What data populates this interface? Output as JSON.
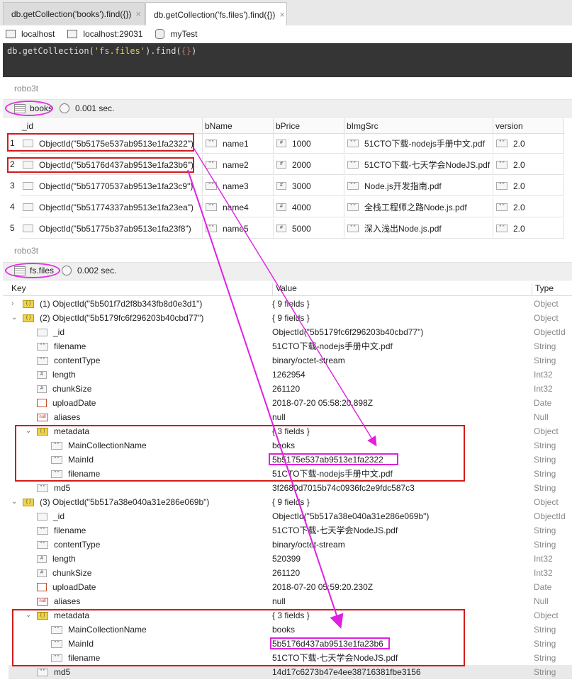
{
  "tabs": [
    {
      "label": "db.getCollection('books').find({})",
      "close": "×"
    },
    {
      "label": "db.getCollection('fs.files').find({})",
      "close": "×"
    }
  ],
  "connection": {
    "host": "localhost",
    "server": "localhost:29031",
    "database": "myTest"
  },
  "shell": {
    "prefix": "db.getCollection(",
    "arg": "'fs.files'",
    "mid": ").find(",
    "brace": "{}",
    "suffix": ")"
  },
  "books_panel": {
    "title": "robo3t",
    "collection": "books",
    "time": "0.001 sec.",
    "columns": [
      "_id",
      "bName",
      "bPrice",
      "bImgSrc",
      "version"
    ],
    "rows": [
      {
        "n": "1",
        "id": "ObjectId(\"5b5175e537ab9513e1fa2322\")",
        "bName": "name1",
        "bPrice": "1000",
        "bImgSrc": "51CTO下载-nodejs手册中文.pdf",
        "version": "2.0"
      },
      {
        "n": "2",
        "id": "ObjectId(\"5b5176d437ab9513e1fa23b6\")",
        "bName": "name2",
        "bPrice": "2000",
        "bImgSrc": "51CTO下载-七天学会NodeJS.pdf",
        "version": "2.0"
      },
      {
        "n": "3",
        "id": "ObjectId(\"5b51770537ab9513e1fa23c9\")",
        "bName": "name3",
        "bPrice": "3000",
        "bImgSrc": "Node.js开发指南.pdf",
        "version": "2.0"
      },
      {
        "n": "4",
        "id": "ObjectId(\"5b51774337ab9513e1fa23ea\")",
        "bName": "name4",
        "bPrice": "4000",
        "bImgSrc": "全栈工程师之路Node.js.pdf",
        "version": "2.0"
      },
      {
        "n": "5",
        "id": "ObjectId(\"5b51775b37ab9513e1fa23f8\")",
        "bName": "name5",
        "bPrice": "5000",
        "bImgSrc": "深入浅出Node.js.pdf",
        "version": "2.0"
      }
    ]
  },
  "files_panel": {
    "title": "robo3t",
    "collection": "fs.files",
    "time": "0.002 sec.",
    "headers": {
      "key": "Key",
      "value": "Value",
      "type": "Type"
    },
    "rows": [
      {
        "arrow": "›",
        "icon": "obj",
        "key": "(1) ObjectId(\"5b501f7d2f8b343fb8d0e3d1\")",
        "value": "{ 9 fields }",
        "type": "Object"
      },
      {
        "arrow": "⌄",
        "icon": "obj",
        "key": "(2) ObjectId(\"5b5179fc6f296203b40cbd77\")",
        "value": "{ 9 fields }",
        "type": "Object"
      },
      {
        "icon": "oid",
        "key": "_id",
        "value": "ObjectId(\"5b5179fc6f296203b40cbd77\")",
        "type": "ObjectId"
      },
      {
        "icon": "str",
        "key": "filename",
        "value": "51CTO下载-nodejs手册中文.pdf",
        "type": "String"
      },
      {
        "icon": "str",
        "key": "contentType",
        "value": "binary/octet-stream",
        "type": "String"
      },
      {
        "icon": "num",
        "key": "length",
        "value": "1262954",
        "type": "Int32"
      },
      {
        "icon": "num",
        "key": "chunkSize",
        "value": "261120",
        "type": "Int32"
      },
      {
        "icon": "date",
        "key": "uploadDate",
        "value": "2018-07-20 05:58:20.898Z",
        "type": "Date"
      },
      {
        "icon": "null",
        "key": "aliases",
        "value": "null",
        "type": "Null"
      },
      {
        "arrow": "⌄",
        "icon": "obj",
        "key": "metadata",
        "value": "{ 3 fields }",
        "type": "Object"
      },
      {
        "icon": "str",
        "key": "MainCollectionName",
        "value": "books",
        "type": "String"
      },
      {
        "icon": "str",
        "key": "MainId",
        "value": "5b5175e537ab9513e1fa2322",
        "type": "String"
      },
      {
        "icon": "str",
        "key": "filename",
        "value": "51CTO下载-nodejs手册中文.pdf",
        "type": "String"
      },
      {
        "icon": "str",
        "key": "md5",
        "value": "3f2680d7015b74c0936fc2e9fdc587c3",
        "type": "String"
      },
      {
        "arrow": "⌄",
        "icon": "obj",
        "key": "(3) ObjectId(\"5b517a38e040a31e286e069b\")",
        "value": "{ 9 fields }",
        "type": "Object"
      },
      {
        "icon": "oid",
        "key": "_id",
        "value": "ObjectId(\"5b517a38e040a31e286e069b\")",
        "type": "ObjectId"
      },
      {
        "icon": "str",
        "key": "filename",
        "value": "51CTO下载-七天学会NodeJS.pdf",
        "type": "String"
      },
      {
        "icon": "str",
        "key": "contentType",
        "value": "binary/octet-stream",
        "type": "String"
      },
      {
        "icon": "num",
        "key": "length",
        "value": "520399",
        "type": "Int32"
      },
      {
        "icon": "num",
        "key": "chunkSize",
        "value": "261120",
        "type": "Int32"
      },
      {
        "icon": "date",
        "key": "uploadDate",
        "value": "2018-07-20 05:59:20.230Z",
        "type": "Date"
      },
      {
        "icon": "null",
        "key": "aliases",
        "value": "null",
        "type": "Null"
      },
      {
        "arrow": "⌄",
        "icon": "obj",
        "key": "metadata",
        "value": "{ 3 fields }",
        "type": "Object"
      },
      {
        "icon": "str",
        "key": "MainCollectionName",
        "value": "books",
        "type": "String"
      },
      {
        "icon": "str",
        "key": "MainId",
        "value": "5b5176d437ab9513e1fa23b6",
        "type": "String"
      },
      {
        "icon": "str",
        "key": "filename",
        "value": "51CTO下载-七天学会NodeJS.pdf",
        "type": "String"
      },
      {
        "icon": "str",
        "key": "md5",
        "value": "14d17c6273b47e4ee38716381fbe3156",
        "type": "String"
      }
    ]
  },
  "colors": {
    "annotation_red": "#d21b1b",
    "annotation_magenta": "#e020e0",
    "shell_bg": "#353535"
  }
}
